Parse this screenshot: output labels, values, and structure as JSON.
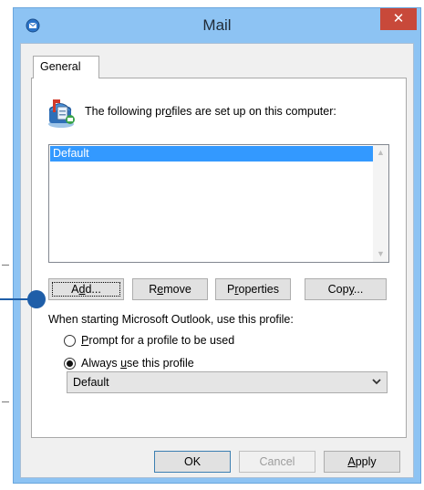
{
  "window": {
    "title": "Mail",
    "close_glyph": "✕",
    "icons": [
      "mail-app-icon",
      "close-icon"
    ]
  },
  "tabs": [
    {
      "label": "General",
      "selected": true
    }
  ],
  "intro": {
    "before": "The following pr",
    "underlined": "o",
    "after": "files are set up on this computer:",
    "icon": "mailbox-icon"
  },
  "profile_list": {
    "items": [
      {
        "label": "Default",
        "selected": true
      }
    ],
    "scroll_up_glyph": "▲",
    "scroll_down_glyph": "▼"
  },
  "profile_buttons": {
    "add": {
      "before": "A",
      "underlined": "d",
      "after": "d..."
    },
    "remove": {
      "before": "R",
      "underlined": "e",
      "after": "move"
    },
    "properties": {
      "before": "P",
      "underlined": "r",
      "after": "operties"
    },
    "copy": {
      "before": "Cop",
      "underlined": "y",
      "after": "..."
    }
  },
  "startup": {
    "label": "When starting Microsoft Outlook, use this profile:",
    "options": [
      {
        "before": "",
        "underlined": "P",
        "after": "rompt for a profile to be used",
        "checked": false
      },
      {
        "before": "Always ",
        "underlined": "u",
        "after": "se this profile",
        "checked": true
      }
    ],
    "selected_profile": "Default"
  },
  "dialog_buttons": {
    "ok": "OK",
    "cancel": "Cancel",
    "apply": {
      "before": "",
      "underlined": "A",
      "after": "pply"
    }
  },
  "colors": {
    "frame": "#8dc3f3",
    "close": "#c8493a",
    "selection": "#3399ff",
    "annotation": "#1f5ea8"
  }
}
